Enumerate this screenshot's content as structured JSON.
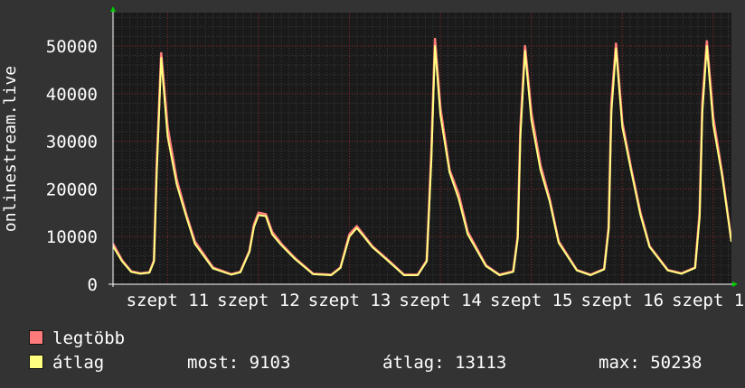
{
  "chart_data": {
    "type": "line",
    "ylabel": "onlinestream.live",
    "ylim": [
      0,
      57000
    ],
    "yticks": [
      0,
      10000,
      20000,
      30000,
      40000,
      50000
    ],
    "ytick_labels": [
      "0",
      "10000",
      "20000",
      "30000",
      "40000",
      "50000"
    ],
    "xlim": [
      10.4,
      17.2
    ],
    "xticks": [
      11,
      12,
      13,
      14,
      15,
      16,
      17
    ],
    "xtick_labels": [
      "szept 11",
      "szept 12",
      "szept 13",
      "szept 14",
      "szept 15",
      "szept 16",
      "szept 17"
    ],
    "grid": true,
    "legend_position": "bottom",
    "series": [
      {
        "name": "legtöbb",
        "color": "#ff7b7b",
        "x": [
          10.4,
          10.5,
          10.6,
          10.7,
          10.8,
          10.85,
          10.88,
          10.93,
          11.0,
          11.1,
          11.2,
          11.3,
          11.5,
          11.7,
          11.8,
          11.9,
          11.95,
          12.0,
          12.08,
          12.15,
          12.25,
          12.4,
          12.6,
          12.8,
          12.9,
          13.0,
          13.08,
          13.15,
          13.25,
          13.4,
          13.6,
          13.75,
          13.85,
          13.9,
          13.94,
          14.0,
          14.1,
          14.2,
          14.3,
          14.5,
          14.65,
          14.8,
          14.85,
          14.88,
          14.93,
          15.0,
          15.1,
          15.2,
          15.3,
          15.5,
          15.65,
          15.8,
          15.85,
          15.88,
          15.93,
          16.0,
          16.1,
          16.2,
          16.3,
          16.5,
          16.65,
          16.8,
          16.85,
          16.88,
          16.93,
          17.0,
          17.1,
          17.2
        ],
        "values": [
          8500,
          5000,
          2700,
          2300,
          2500,
          5000,
          25000,
          48500,
          33000,
          22000,
          15000,
          9000,
          3500,
          2100,
          2600,
          7000,
          12500,
          15000,
          14700,
          11000,
          8500,
          5500,
          2200,
          2000,
          3500,
          10500,
          12200,
          10500,
          8000,
          5500,
          2000,
          2000,
          5000,
          28000,
          51500,
          37000,
          24000,
          19000,
          11000,
          4000,
          2000,
          2700,
          10000,
          33000,
          50000,
          36000,
          25000,
          18000,
          9000,
          3000,
          2000,
          3200,
          12000,
          38000,
          50500,
          34000,
          24000,
          15000,
          8000,
          3000,
          2300,
          3500,
          15000,
          38000,
          51000,
          35000,
          23000,
          9100
        ]
      },
      {
        "name": "átlag",
        "color": "#ffff80",
        "x": [
          10.4,
          10.5,
          10.6,
          10.7,
          10.8,
          10.85,
          10.88,
          10.93,
          11.0,
          11.1,
          11.2,
          11.3,
          11.5,
          11.7,
          11.8,
          11.9,
          11.95,
          12.0,
          12.08,
          12.15,
          12.25,
          12.4,
          12.6,
          12.8,
          12.9,
          13.0,
          13.08,
          13.15,
          13.25,
          13.4,
          13.6,
          13.75,
          13.85,
          13.9,
          13.94,
          14.0,
          14.1,
          14.2,
          14.3,
          14.5,
          14.65,
          14.8,
          14.85,
          14.88,
          14.93,
          15.0,
          15.1,
          15.2,
          15.3,
          15.5,
          15.65,
          15.8,
          15.85,
          15.88,
          15.93,
          16.0,
          16.1,
          16.2,
          16.3,
          16.5,
          16.65,
          16.8,
          16.85,
          16.88,
          16.93,
          17.0,
          17.1,
          17.2
        ],
        "values": [
          8000,
          4800,
          2600,
          2200,
          2400,
          4800,
          23000,
          47500,
          31000,
          21000,
          14500,
          8500,
          3300,
          2000,
          2500,
          6800,
          12000,
          14500,
          14300,
          10500,
          8200,
          5300,
          2100,
          1900,
          3400,
          10000,
          11800,
          10200,
          7800,
          5300,
          1900,
          1900,
          4800,
          26000,
          50000,
          35500,
          23500,
          18000,
          10500,
          3800,
          1900,
          2600,
          9500,
          31000,
          49000,
          34500,
          24000,
          17500,
          8700,
          2900,
          1900,
          3100,
          11500,
          36000,
          49500,
          33000,
          23500,
          14500,
          7800,
          2900,
          2200,
          3400,
          14000,
          36000,
          50000,
          33500,
          22500,
          8900
        ]
      }
    ]
  },
  "legend": {
    "items": [
      {
        "label": "legtöbb",
        "color": "#ff7b7b"
      },
      {
        "label": "átlag",
        "color": "#ffff80"
      }
    ],
    "current_label": "most:",
    "current_value": "9103",
    "avg_label": "átlag:",
    "avg_value": "13113",
    "max_label": "max:",
    "max_value": "50238"
  }
}
